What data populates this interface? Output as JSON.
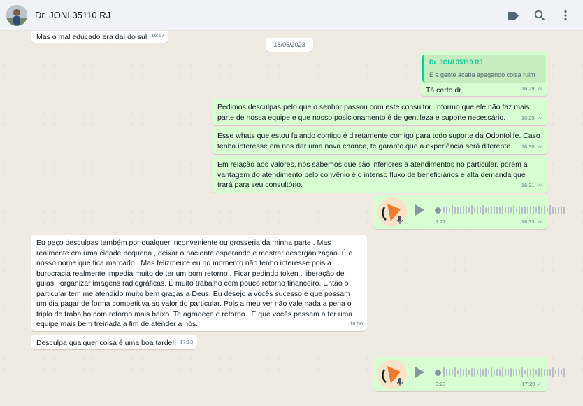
{
  "header": {
    "contact_name": "Dr. JONI 35110 RJ"
  },
  "date_separator": "18/05/2023",
  "messages": {
    "m0": {
      "text": "Mas o mal educado era daí do sul",
      "time": "16:17"
    },
    "m1": {
      "quote_author": "Dr. JONI 35110 RJ",
      "quote_text": "E a gente acaba apagando coisa ruim",
      "text": "Tá certo dr.",
      "time": "16:29"
    },
    "m2": {
      "text": "Pedimos desculpas pelo que o senhor passou com este consultor. Informo que ele não faz mais parte de nossa equipe e que nosso posicionamento é de gentileza e suporte necessário.",
      "time": "16:29"
    },
    "m3": {
      "text": "Esse whats que estou falando contigo é diretamente comigo para todo suporte da Odontolife. Caso tenha interesse em nos dar uma nova chance, te garanto que a experiência será diferente.",
      "time": "16:30"
    },
    "m4": {
      "text": "Em relação aos valores, nós sabemos que são inferiores a atendimentos no particular, porém a vantagem do atendimento pelo convênio é o intenso fluxo de beneficiários e alta demanda que trará para seu consultório.",
      "time": "16:31"
    },
    "m5": {
      "duration": "1:27",
      "time": "16:33"
    },
    "m6": {
      "text": "Eu peço desculpas também por qualquer inconveniente ou grosseria da minha parte . Mas realmente em uma cidade pequena , deixar o paciente esperando e mostrar desorganização. É o nosso nome que fica marcado . Mas felizmente eu no momento não tenho interesse pois a burocracia realmente impedia muito de ter um bom retorno . Ficar pedindo token , liberação de guias , organizar imagens radiográficas. É muito trabalho com pouco retorno financeiro. Então o particular tem me atendido muito bem graças a Deus. Eu desejo a vocês sucesso e que possam um dia pagar de forma competitiva ao valor do particular. Pois a meu ver não vale nada a pena o triplo do trabalho com retorno mais baixo. Te agradeço o retorno . E que vocês passam a ter uma equipe mais bem treinada a fim de atender a nós.",
      "time": "16:56"
    },
    "m7": {
      "text": "Desculpa qualquer coisa é uma boa tarde!!",
      "time": "17:13"
    },
    "m8": {
      "duration": "0:23",
      "time": "17:29"
    }
  },
  "icons": [
    "label-icon",
    "search-icon",
    "menu-icon",
    "play-icon",
    "mic-icon",
    "double-check-icon",
    "single-check-icon"
  ],
  "colors": {
    "incoming": "#ffffff",
    "outgoing": "#d9fdd3",
    "background": "#efeae2",
    "accent": "#06cf9c"
  }
}
